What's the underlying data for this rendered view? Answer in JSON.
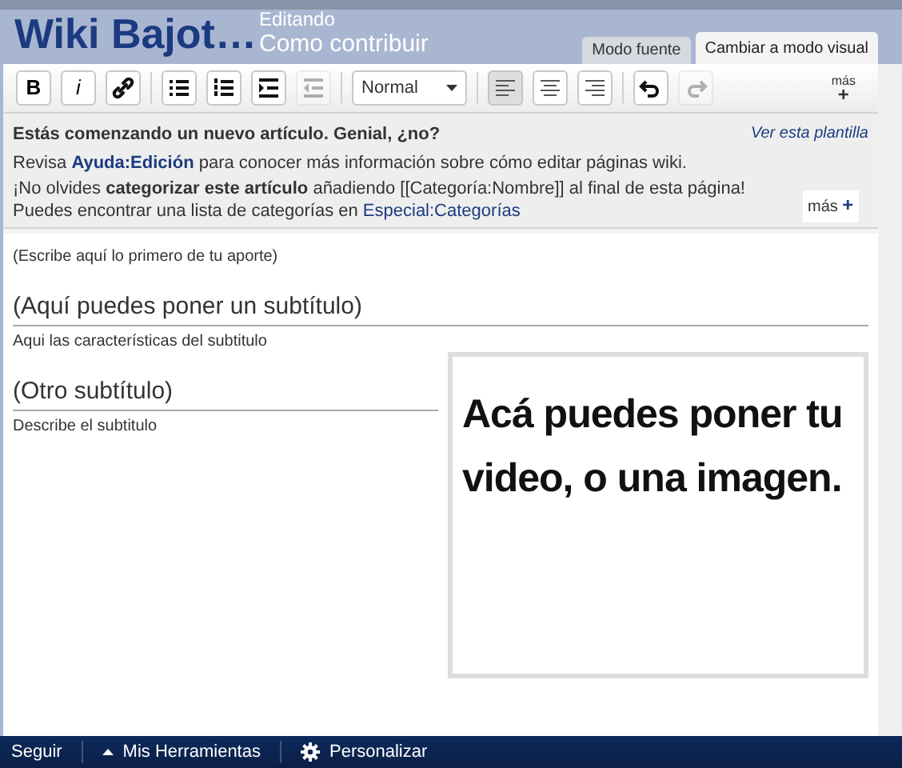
{
  "header": {
    "wiki_name": "Wiki Bajot…",
    "status": "Editando",
    "page_title": "Como contribuir"
  },
  "tabs": [
    {
      "label": "Modo fuente",
      "selected": false
    },
    {
      "label": "Cambiar a modo visual",
      "selected": true
    }
  ],
  "toolbar": {
    "format_buttons": [
      {
        "kind": "text",
        "label": "B",
        "disabled": false
      },
      {
        "kind": "text",
        "label": "i",
        "disabled": false
      },
      {
        "kind": "link",
        "disabled": false
      }
    ],
    "list_buttons": [
      {
        "kind": "bullets",
        "disabled": false
      },
      {
        "kind": "numbers",
        "disabled": false
      },
      {
        "kind": "indent",
        "disabled": false
      },
      {
        "kind": "outdent",
        "disabled": true
      }
    ],
    "style_dropdown": {
      "value": "Normal"
    },
    "align_buttons": [
      {
        "kind": "left",
        "selected": true
      },
      {
        "kind": "center",
        "selected": false
      },
      {
        "kind": "right",
        "selected": false
      }
    ],
    "history_buttons": [
      {
        "kind": "undo",
        "disabled": false
      },
      {
        "kind": "redo",
        "disabled": true
      }
    ],
    "more": {
      "label": "más",
      "symbol": "+"
    }
  },
  "notice": {
    "title": "Estás comenzando un nuevo artículo. Genial, ¿no?",
    "template_link": "Ver esta plantilla",
    "line1": {
      "before": "Revisa",
      "link": "Ayuda:Edición",
      "after": "para conocer más información sobre cómo editar páginas wiki."
    },
    "line2": {
      "before": "¡No olvides **categorizar este artículo** añadiendo [[Categoría:Nombre]] al final de esta página! Puedes encontrar una lista de categorías en",
      "link": "Especial:Categorías"
    },
    "more": {
      "label": "más",
      "symbol": "+"
    }
  },
  "editor": {
    "blocks": [
      {
        "kind": "paragraph",
        "text": "(Escribe aquí lo primero de tu aporte)"
      },
      {
        "kind": "heading",
        "text": "(Aquí puedes poner un subtítulo)"
      },
      {
        "kind": "paragraph",
        "text": "Aqui las características del subtitulo"
      },
      {
        "kind": "heading",
        "text": "(Otro subtítulo)"
      },
      {
        "kind": "paragraph",
        "text": "Describe el subtitulo"
      },
      {
        "kind": "media",
        "text": "Acá puedes poner tu video, o una imagen."
      }
    ]
  },
  "bottom_bar": {
    "items": [
      {
        "kind": "plain",
        "label": "Seguir"
      },
      {
        "kind": "caret",
        "label": "Mis Herramientas"
      },
      {
        "kind": "gear",
        "label": "Personalizar"
      }
    ]
  }
}
